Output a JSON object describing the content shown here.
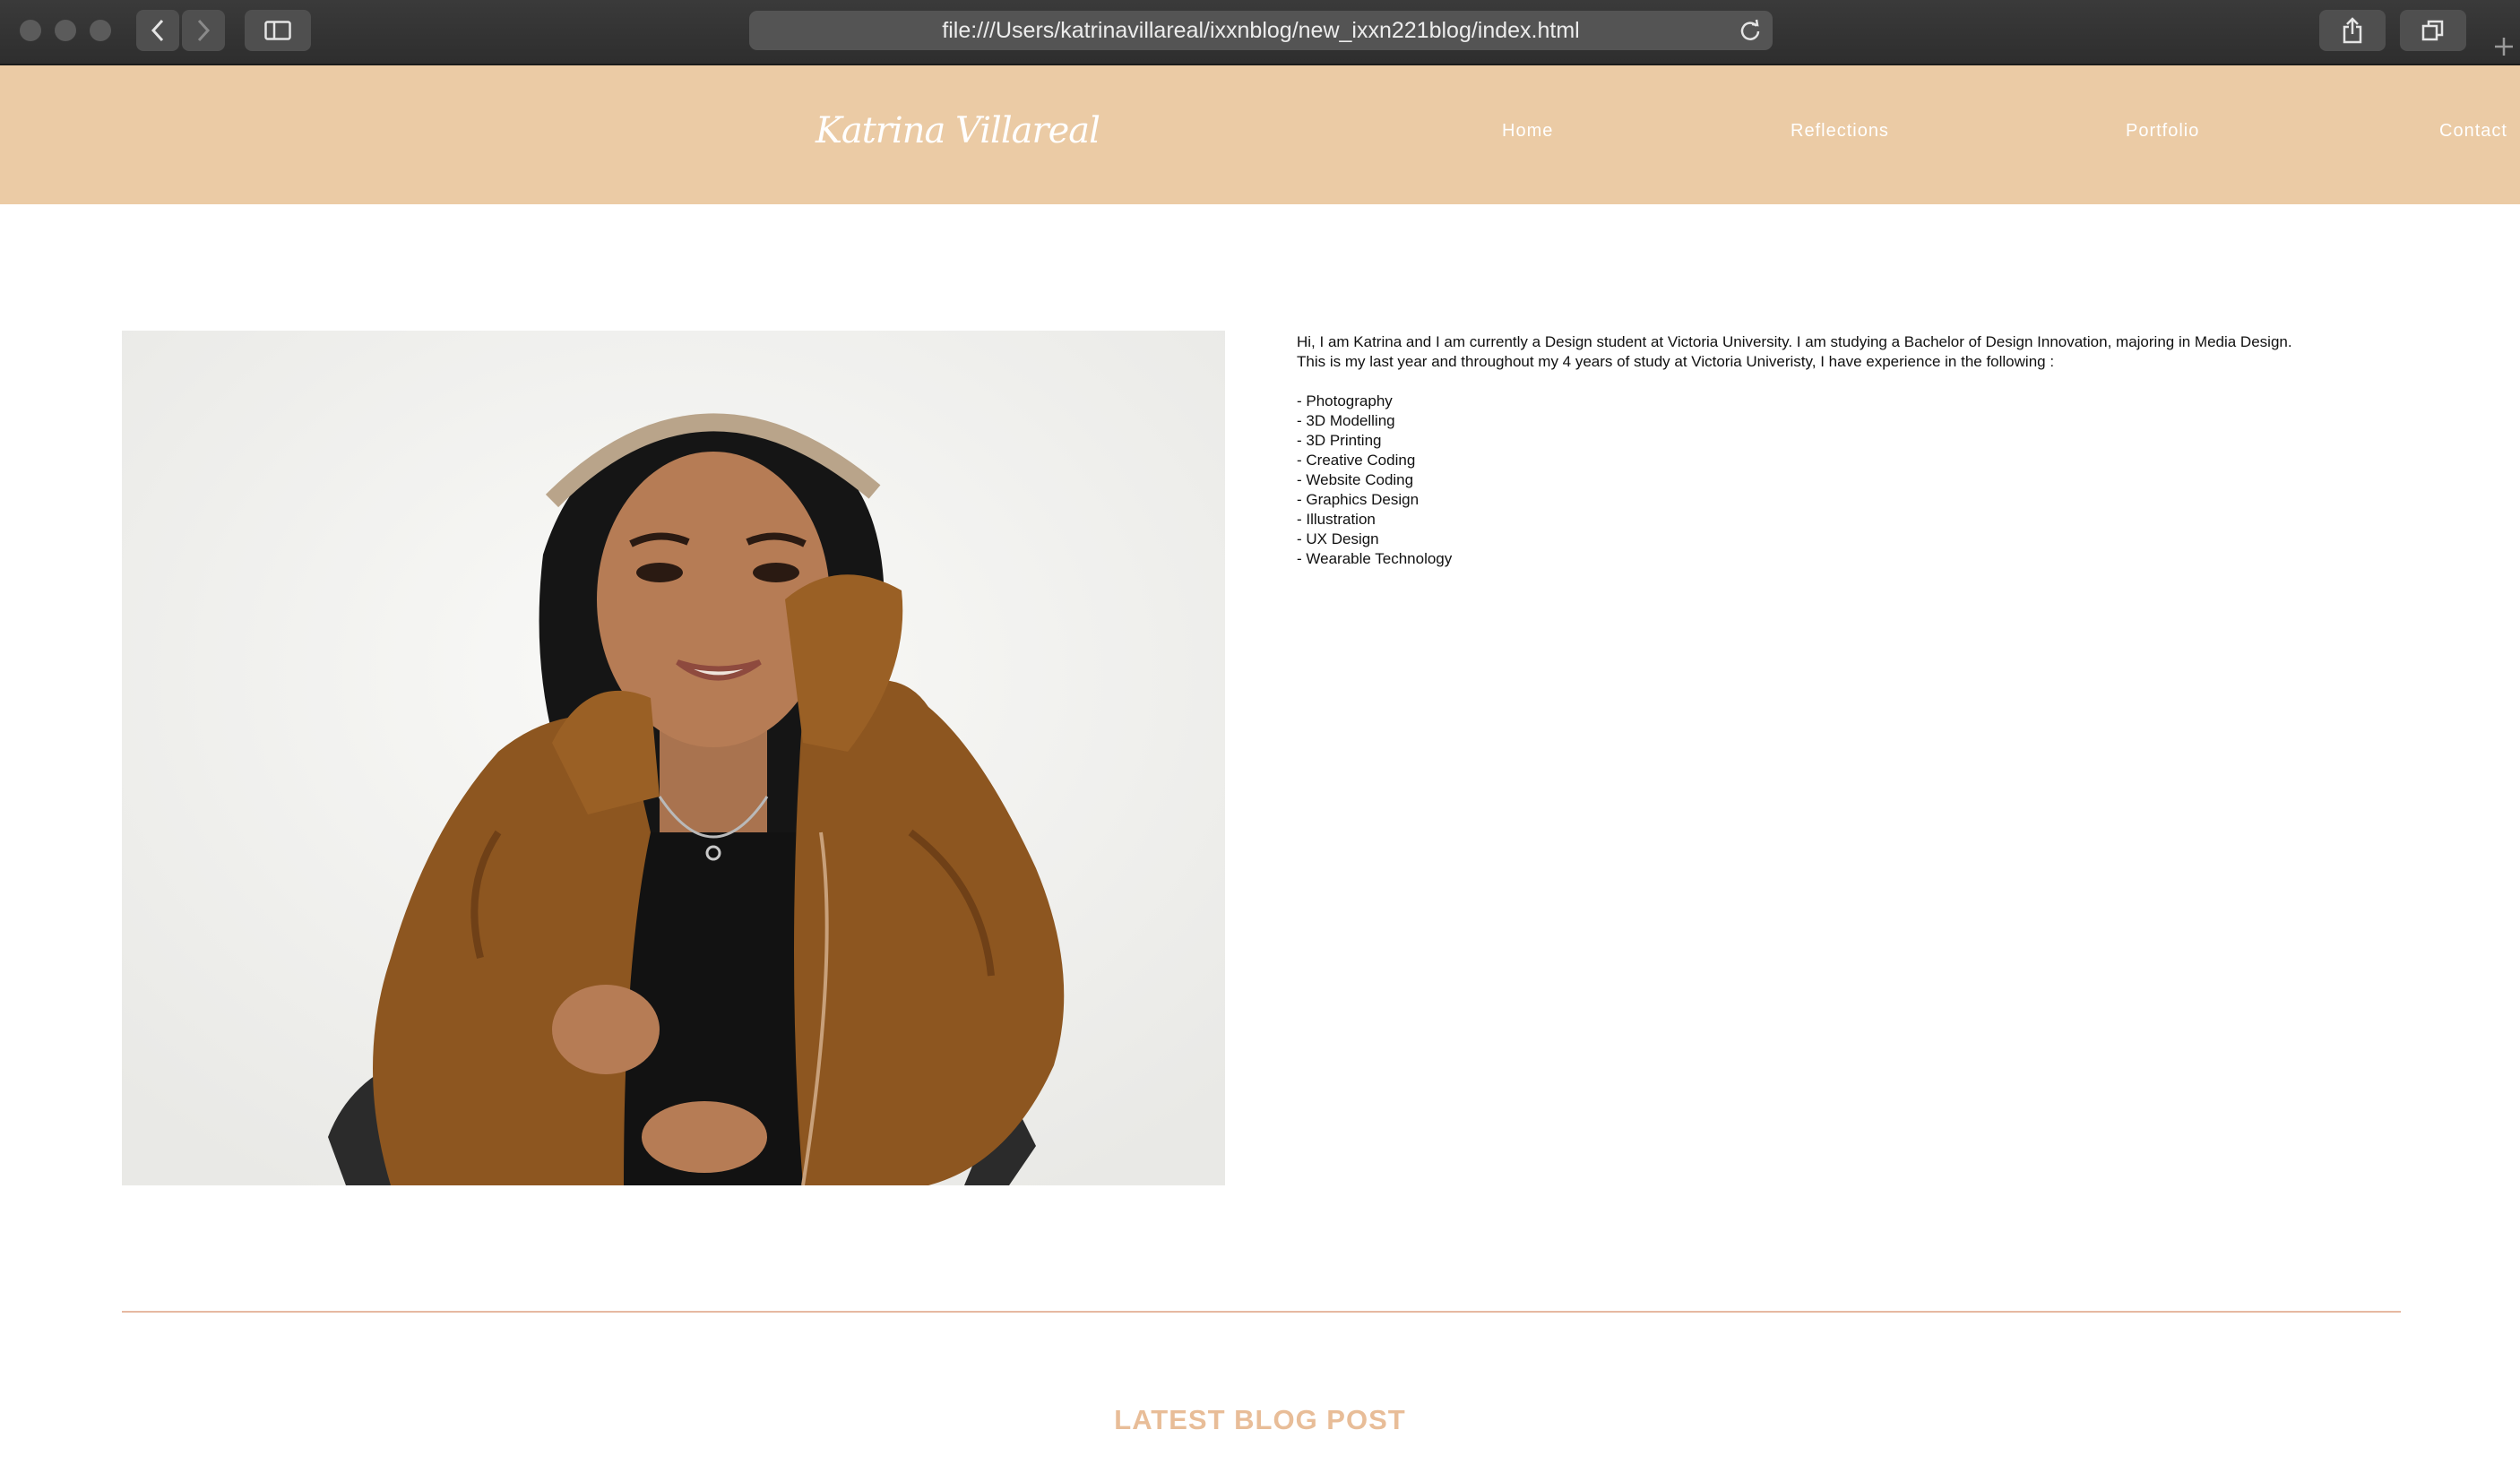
{
  "browser": {
    "url": "file:///Users/katrinavillareal/ixxnblog/new_ixxn221blog/index.html"
  },
  "header": {
    "logo": "Katrina Villareal",
    "nav": [
      "Home",
      "Reflections",
      "Portfolio",
      "Contact"
    ]
  },
  "bio": {
    "intro_line1": "Hi, I am Katrina and I am currently a Design student at Victoria University. I am studying a Bachelor of Design Innovation, majoring in Media Design.",
    "intro_line2": "This is my last year and throughout my 4 years of study at Victoria Univeristy, I have experience in the following :",
    "skills": [
      "- Photography",
      "- 3D Modelling",
      "- 3D Printing",
      "- Creative Coding",
      "- Website Coding",
      "- Graphics Design",
      "- Illustration",
      "- UX Design",
      "- Wearable Technology"
    ]
  },
  "latest_post": {
    "heading": "LATEST BLOG POST"
  },
  "colors": {
    "header_bg": "#ebcba5",
    "accent": "#e8bd98",
    "divider": "#e6b9a2"
  }
}
